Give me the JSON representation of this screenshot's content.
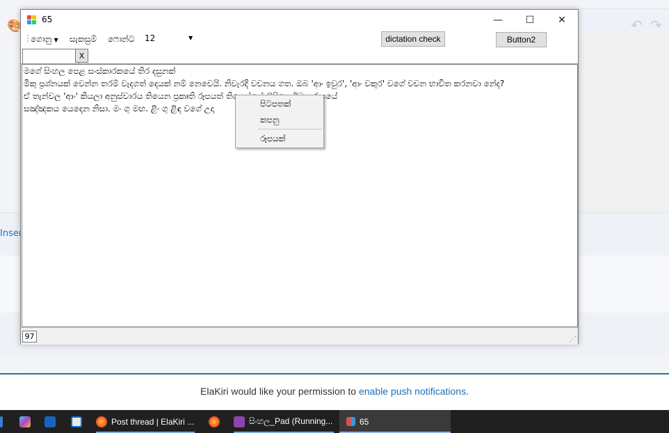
{
  "background": {
    "insert_label": "Inser",
    "notification": {
      "prefix": "ElaKiri would like your permission to ",
      "link": "enable push notifications",
      "suffix": "."
    }
  },
  "taskbar": {
    "items": [
      {
        "label": "Post thread | ElaKiri ...",
        "icon": "firefox-icon"
      },
      {
        "label": "සිංහල_Pad (Running...",
        "icon": "visual-studio-icon"
      },
      {
        "label": "65",
        "icon": "app-form-icon"
      }
    ]
  },
  "window": {
    "title": "65",
    "controls": {
      "minimize": "—",
      "maximize": "☐",
      "close": "✕"
    },
    "menu": {
      "file": "ගොනු",
      "edit": "සැකසුම්",
      "font": "ෆොන්ට",
      "font_size": "12"
    },
    "buttons": {
      "dictation": "dictation check",
      "button2": "Button2"
    },
    "search": {
      "value": "",
      "clear_label": "X"
    },
    "editor_lines": [
      "මගේ සිංහල පෙළ සංස්කාරකයේ තිර දසුනක්",
      "මිකු ප්‍රශ්නයක් වෙන්න තරම් වැදගත් දෙයක් නම් නෙවෙයි. නිවැරදි වචනය ගත. ඔබ 'ආං ඉවුර', 'ආං වකුර' වගේ වචන භාවිත කරනවා නේද?",
      "ඒ තැන්වල 'ආං' කියලා අනුස්වාරය තියෙන ප්‍රකෘති රූපයත් තියෙන්නේ ලිපියෙ ඊවත රූපයේ",
      "සඤ්ඤකය යෙදෙන නිසා. මං ගු මඟ. ළිං ගු ළිඳ වගේ උදා"
    ],
    "status_count": "97"
  },
  "context_menu": {
    "items": [
      "පිටපතක්",
      "කපනු",
      "රූපයක්"
    ]
  }
}
